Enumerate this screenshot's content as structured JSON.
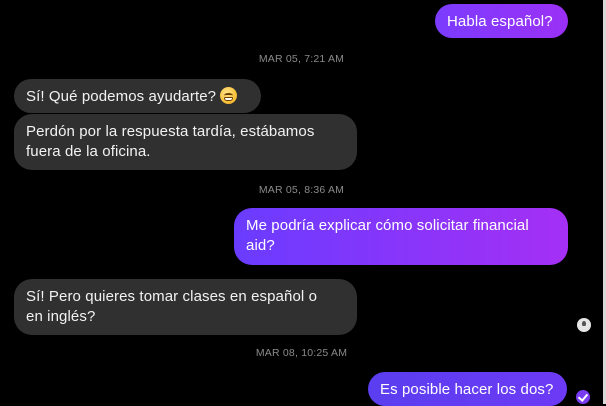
{
  "colors": {
    "background": "#000000",
    "incoming_bubble": "#303030",
    "outgoing_gradient_start": "#6a3cff",
    "outgoing_gradient_end": "#a52ff5",
    "timestamp_text": "#8a8a8a"
  },
  "conversation": {
    "messages": [
      {
        "direction": "outgoing",
        "text": "Habla español?"
      },
      {
        "timestamp": "MAR 05, 7:21 AM"
      },
      {
        "direction": "incoming",
        "text": "Sí!  Qué podemos ayudarte?",
        "emoji": "grinning-face"
      },
      {
        "direction": "incoming",
        "line1": "Perdón por la respuesta tardía, estábamos",
        "line2": "fuera de la oficina."
      },
      {
        "timestamp": "MAR 05, 8:36 AM"
      },
      {
        "direction": "outgoing",
        "line1": "Me podría explicar cómo solicitar financial",
        "line2": "aid?"
      },
      {
        "direction": "incoming",
        "line1": "Sí!  Pero quieres tomar clases en español o",
        "line2": "en inglés?"
      },
      {
        "timestamp": "MAR 08, 10:25 AM"
      },
      {
        "direction": "outgoing",
        "text": "Es posible hacer los dos?",
        "status_icon": "sent-check-icon"
      }
    ]
  }
}
